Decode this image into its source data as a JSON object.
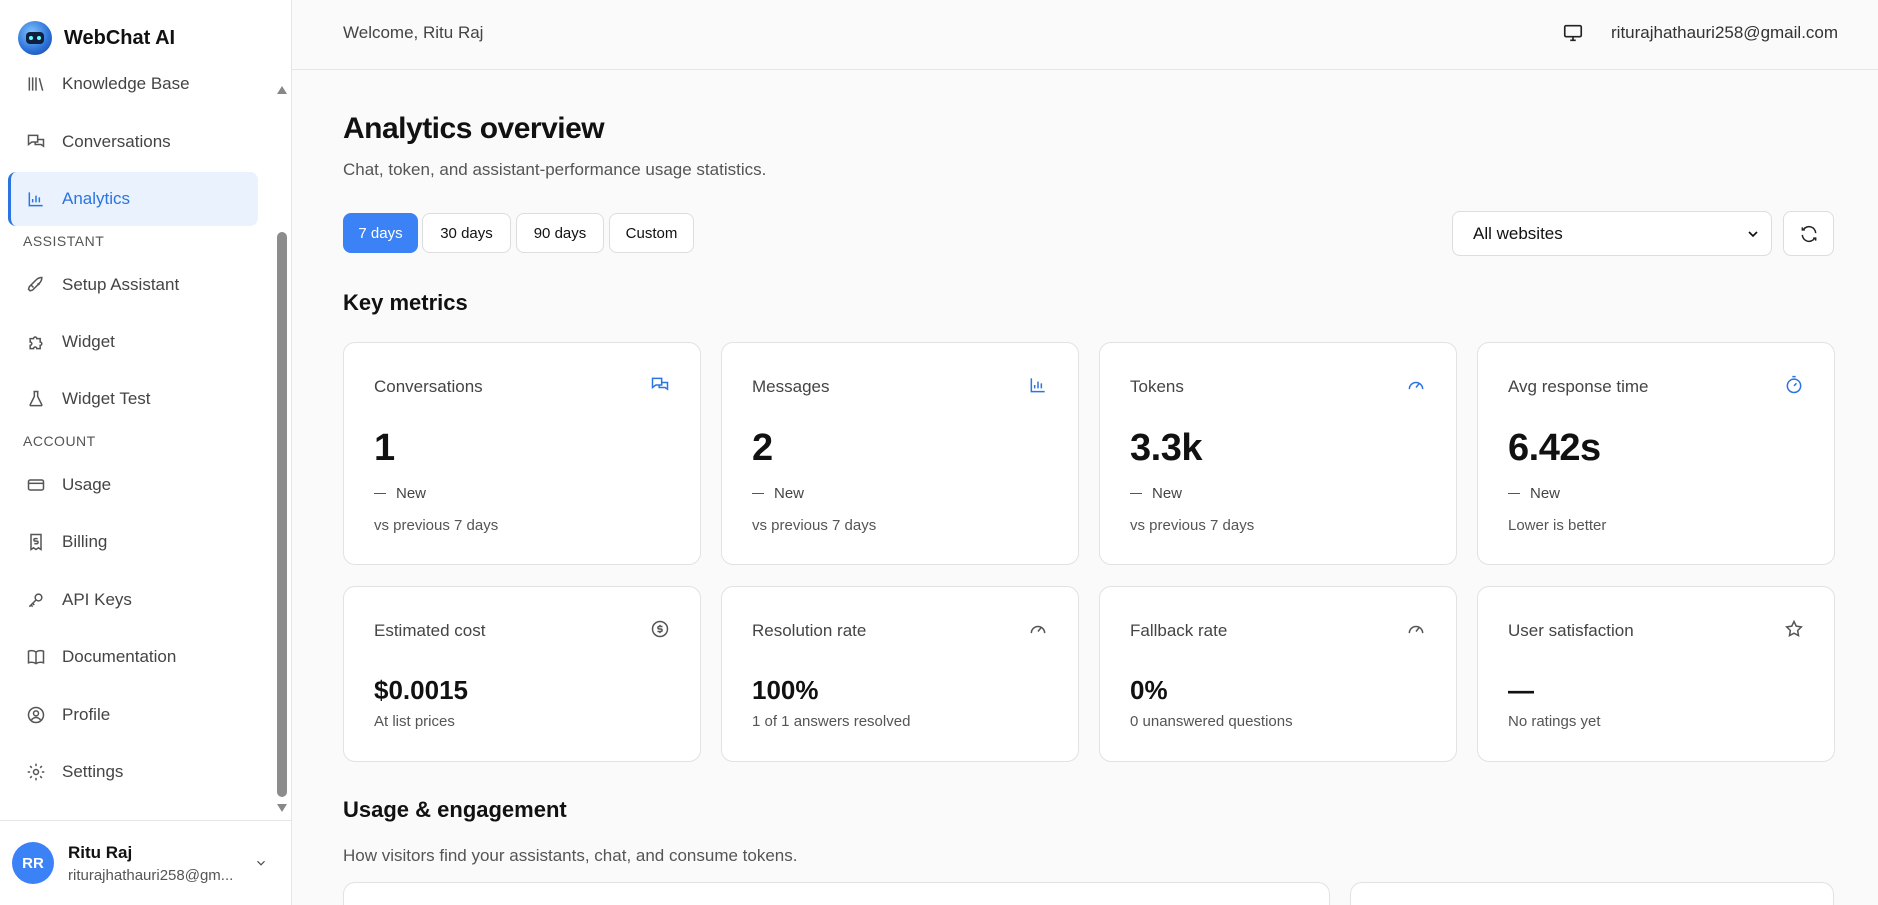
{
  "app": {
    "name": "WebChat AI"
  },
  "sidebar": {
    "items": [
      {
        "key": "knowledge",
        "label": "Knowledge Base",
        "icon": "library-icon"
      },
      {
        "key": "conversations",
        "label": "Conversations",
        "icon": "chat-icon"
      },
      {
        "key": "analytics",
        "label": "Analytics",
        "icon": "bar-chart-icon",
        "active": true
      },
      {
        "key": "setup",
        "label": "Setup Assistant",
        "icon": "rocket-icon"
      },
      {
        "key": "widget",
        "label": "Widget",
        "icon": "puzzle-icon"
      },
      {
        "key": "widgettest",
        "label": "Widget Test",
        "icon": "flask-icon"
      },
      {
        "key": "usage",
        "label": "Usage",
        "icon": "card-icon"
      },
      {
        "key": "billing",
        "label": "Billing",
        "icon": "receipt-icon"
      },
      {
        "key": "apikeys",
        "label": "API Keys",
        "icon": "key-icon"
      },
      {
        "key": "docs",
        "label": "Documentation",
        "icon": "book-icon"
      },
      {
        "key": "profile",
        "label": "Profile",
        "icon": "user-circle-icon"
      },
      {
        "key": "settings",
        "label": "Settings",
        "icon": "gear-icon"
      }
    ],
    "sections": {
      "assistant": "ASSISTANT",
      "account": "ACCOUNT"
    },
    "user": {
      "initials": "RR",
      "name": "Ritu Raj",
      "email": "riturajhathauri258@gm..."
    }
  },
  "topbar": {
    "welcome": "Welcome, Ritu Raj",
    "email": "riturajhathauri258@gmail.com"
  },
  "page": {
    "title": "Analytics overview",
    "subtitle": "Chat, token, and assistant-performance usage statistics.",
    "ranges": [
      "7 days",
      "30 days",
      "90 days",
      "Custom"
    ],
    "selected_range": "7 days",
    "website_filter": "All websites"
  },
  "key_metrics": {
    "title": "Key metrics",
    "top": [
      {
        "label": "Conversations",
        "value": "1",
        "change": "New",
        "note": "vs previous 7 days",
        "icon": "chat-icon"
      },
      {
        "label": "Messages",
        "value": "2",
        "change": "New",
        "note": "vs previous 7 days",
        "icon": "bar-chart-icon"
      },
      {
        "label": "Tokens",
        "value": "3.3k",
        "change": "New",
        "note": "vs previous 7 days",
        "icon": "gauge-icon"
      },
      {
        "label": "Avg response time",
        "value": "6.42s",
        "change": "New",
        "note": "Lower is better",
        "icon": "stopwatch-icon"
      }
    ],
    "bottom": [
      {
        "label": "Estimated cost",
        "value": "$0.0015",
        "sub": "At list prices",
        "icon": "dollar-icon"
      },
      {
        "label": "Resolution rate",
        "value": "100%",
        "sub": "1 of 1 answers resolved",
        "icon": "gauge-icon"
      },
      {
        "label": "Fallback rate",
        "value": "0%",
        "sub": "0 unanswered questions",
        "icon": "gauge-icon"
      },
      {
        "label": "User satisfaction",
        "value": "—",
        "sub": "No ratings yet",
        "icon": "star-icon"
      }
    ]
  },
  "engagement": {
    "title": "Usage & engagement",
    "subtitle": "How visitors find your assistants, chat, and consume tokens."
  },
  "colors": {
    "accent": "#3b82f6",
    "active_text": "#2b74e2",
    "active_bg": "#e9f2fd"
  }
}
